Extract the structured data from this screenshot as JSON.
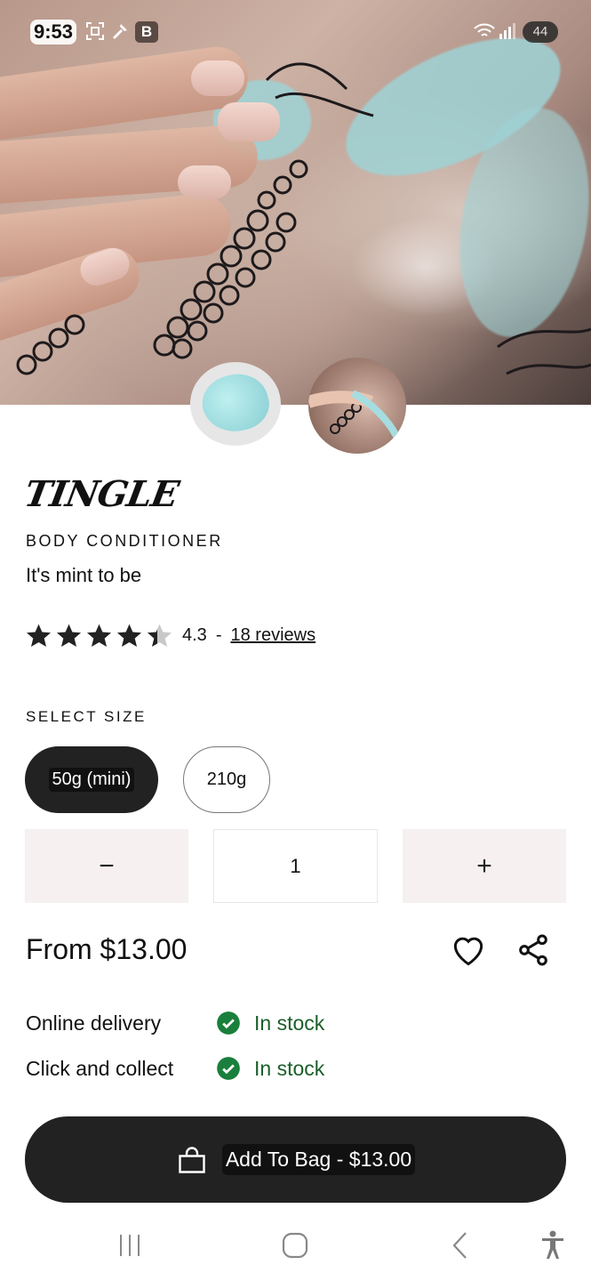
{
  "status_bar": {
    "time": "9:53",
    "badge": "B",
    "battery": "44"
  },
  "product": {
    "name": "TINGLE",
    "category": "BODY CONDITIONER",
    "tagline": "It's mint to be",
    "rating": {
      "stars": 4.3,
      "value_text": "4.3",
      "separator": "-",
      "reviews_link": "18 reviews"
    }
  },
  "size": {
    "label": "SELECT SIZE",
    "options": [
      "50g (mini)",
      "210g"
    ],
    "selected": "50g (mini)"
  },
  "quantity": {
    "minus_label": "−",
    "value": "1",
    "plus_label": "+"
  },
  "price": {
    "text": "From $13.00"
  },
  "availability": [
    {
      "label": "Online delivery",
      "status": "In stock"
    },
    {
      "label": "Click and collect",
      "status": "In stock"
    }
  ],
  "cta": {
    "label": "Add To Bag - $13.00"
  },
  "icons": {
    "wishlist": "heart-icon",
    "share": "share-icon",
    "stock": "check-circle-icon",
    "bag": "shopping-bag-icon"
  },
  "colors": {
    "primary_button": "#222222",
    "stock_green": "#1a7f3c",
    "qty_bg": "#f6f0f1"
  }
}
